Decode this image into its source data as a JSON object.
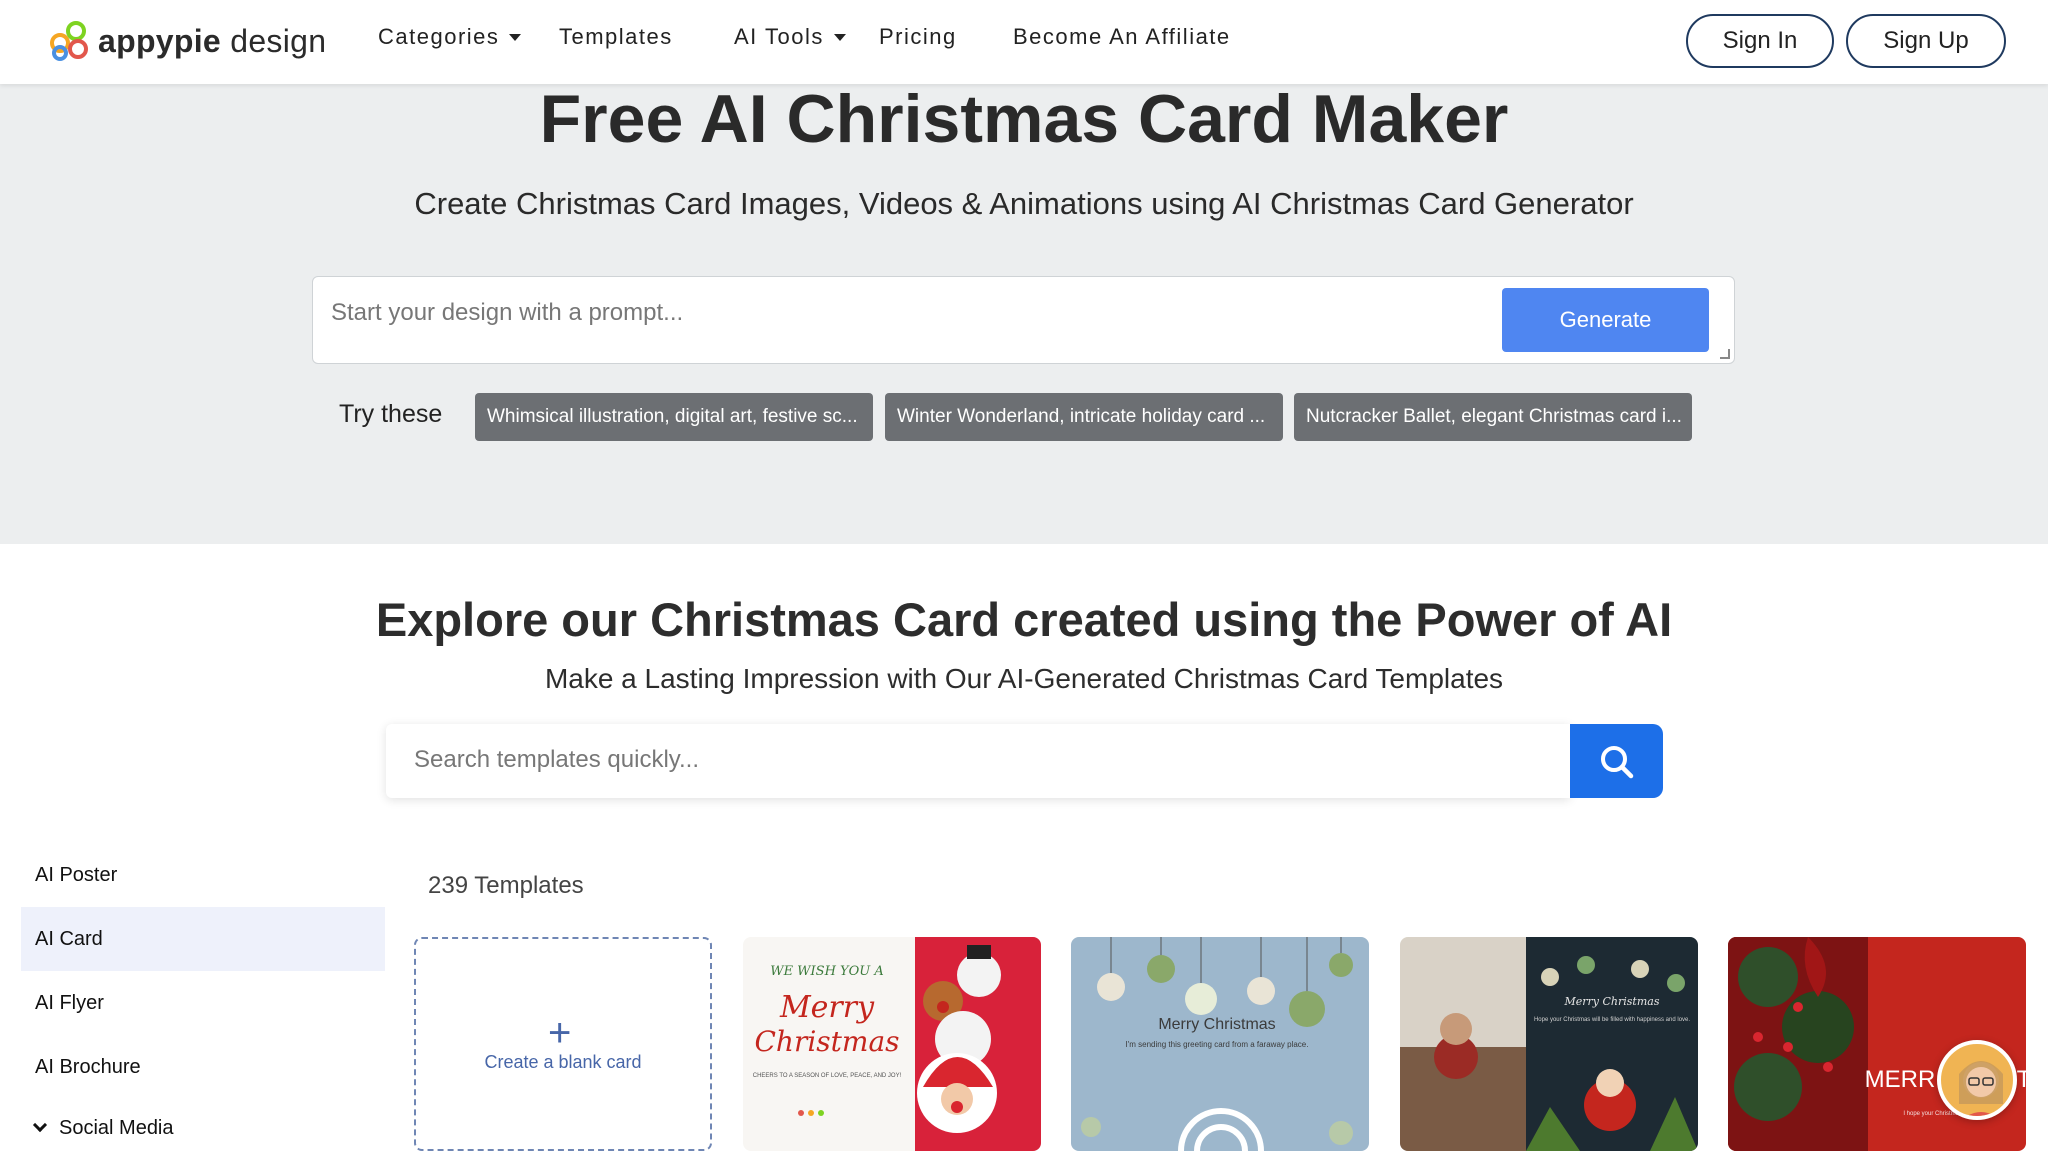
{
  "header": {
    "logo": {
      "brand": "appypie",
      "suffix": "design"
    },
    "nav": [
      {
        "label": "Categories",
        "has_dropdown": true
      },
      {
        "label": "Templates",
        "has_dropdown": false
      },
      {
        "label": "AI Tools",
        "has_dropdown": true
      },
      {
        "label": "Pricing",
        "has_dropdown": false
      },
      {
        "label": "Become An Affiliate",
        "has_dropdown": false
      }
    ],
    "sign_in": "Sign In",
    "sign_up": "Sign Up"
  },
  "hero": {
    "title": "Free AI Christmas Card Maker",
    "subtitle": "Create Christmas Card Images, Videos & Animations using AI Christmas Card Generator",
    "prompt_placeholder": "Start your design with a prompt...",
    "generate_label": "Generate",
    "try_label": "Try these",
    "suggestions": [
      "Whimsical illustration, digital art, festive sc...",
      "Winter Wonderland, intricate holiday card ...",
      "Nutcracker Ballet, elegant Christmas card i..."
    ]
  },
  "explore": {
    "title": "Explore our Christmas Card created using the Power of AI",
    "subtitle": "Make a Lasting Impression with Our AI-Generated Christmas Card Templates",
    "search_placeholder": "Search templates quickly..."
  },
  "sidebar": {
    "items": [
      {
        "label": "AI Poster",
        "active": false
      },
      {
        "label": "AI Card",
        "active": true
      },
      {
        "label": "AI Flyer",
        "active": false
      },
      {
        "label": "AI Brochure",
        "active": false
      },
      {
        "label": "Social Media",
        "active": false,
        "expandable": true
      }
    ]
  },
  "templates": {
    "count_label": "239 Templates",
    "blank_label": "Create a blank card",
    "cards": [
      {
        "title_line1": "WE WISH YOU A",
        "title_line2": "Merry",
        "title_line3": "Christmas",
        "caption": "CHEERS TO A SEASON OF LOVE, PEACE, AND JOY!"
      },
      {
        "title": "Merry Christmas",
        "caption": "I'm sending this greeting card from a faraway place."
      },
      {
        "title": "Merry Christmas",
        "caption": "Hope your Christmas will be filled with happiness and love."
      },
      {
        "title": "MERR CHRIST",
        "caption": "I hope your Christmas is filled w..."
      }
    ]
  },
  "colors": {
    "hero_bg": "#eceeef",
    "generate": "#4f86f1",
    "search_button": "#1d6fe8",
    "chip": "#6c6f73",
    "sidebar_active": "#eef1fb"
  }
}
